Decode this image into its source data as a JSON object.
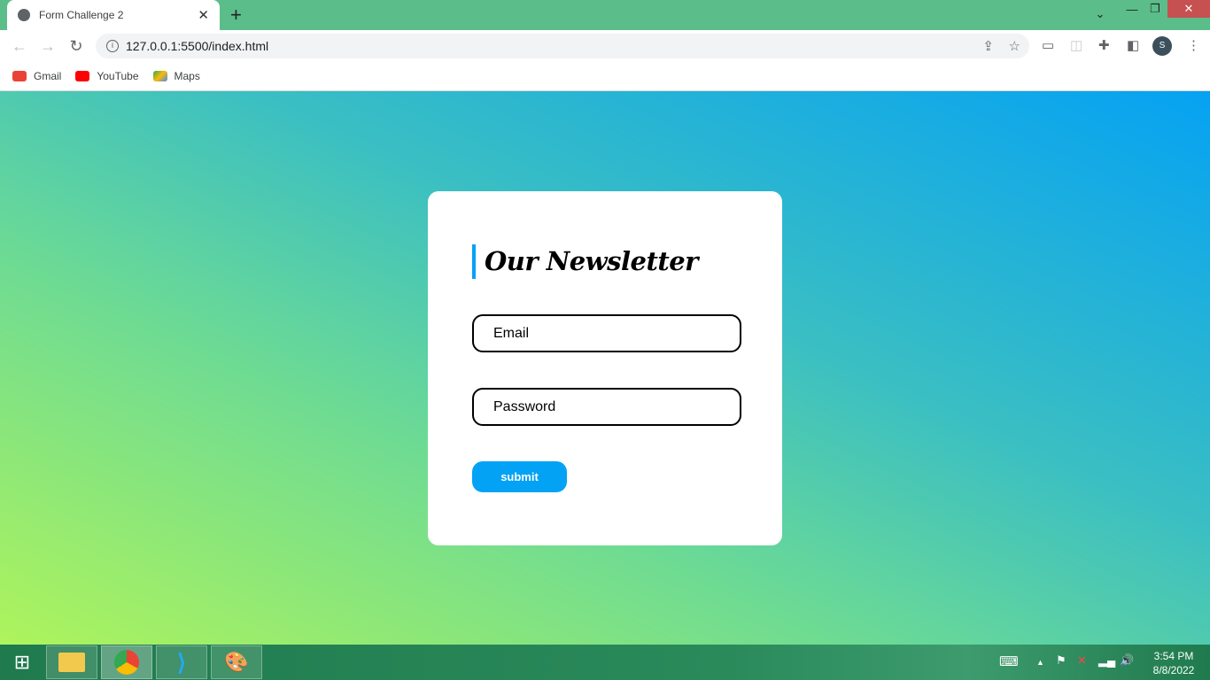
{
  "browser": {
    "tab_title": "Form Challenge 2",
    "tab_close": "✕",
    "new_tab": "+",
    "url": "127.0.0.1:5500/index.html",
    "profile_initial": "S",
    "bookmarks": [
      {
        "label": "Gmail",
        "icon": "gmail-icon",
        "color": "#ea4335"
      },
      {
        "label": "YouTube",
        "icon": "youtube-icon",
        "color": "#ff0000"
      },
      {
        "label": "Maps",
        "icon": "maps-icon",
        "color": "#34a853"
      }
    ]
  },
  "form": {
    "title": "Our Newsletter",
    "email_placeholder": "Email",
    "password_placeholder": "Password",
    "submit_label": "submit",
    "accent_color": "#03a2f5"
  },
  "taskbar": {
    "time": "3:54 PM",
    "date": "8/8/2022"
  }
}
